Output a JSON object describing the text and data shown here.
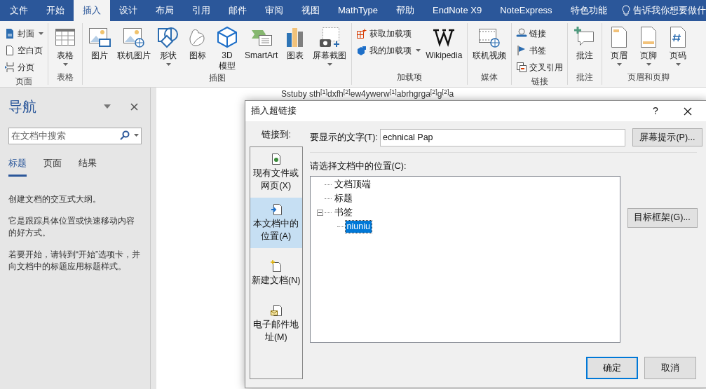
{
  "tabs": [
    {
      "label": "文件",
      "selected": false
    },
    {
      "label": "开始",
      "selected": false
    },
    {
      "label": "插入",
      "selected": true
    },
    {
      "label": "设计",
      "selected": false
    },
    {
      "label": "布局",
      "selected": false
    },
    {
      "label": "引用",
      "selected": false
    },
    {
      "label": "邮件",
      "selected": false
    },
    {
      "label": "审阅",
      "selected": false
    },
    {
      "label": "视图",
      "selected": false
    },
    {
      "label": "MathType",
      "selected": false
    },
    {
      "label": "帮助",
      "selected": false
    },
    {
      "label": "EndNote X9",
      "selected": false
    },
    {
      "label": "NoteExpress",
      "selected": false
    },
    {
      "label": "特色功能",
      "selected": false
    }
  ],
  "tell_me": "告诉我你想要做什",
  "ribbon": [
    {
      "label": "页面",
      "columns": [
        {
          "kind": "stack",
          "items": [
            {
              "label": "封面",
              "dropdown": true
            },
            {
              "label": "空白页",
              "dropdown": false
            },
            {
              "label": "分页",
              "dropdown": false
            }
          ]
        }
      ]
    },
    {
      "label": "表格",
      "columns": [
        {
          "kind": "large",
          "label": "表格",
          "dropdown": true
        }
      ]
    },
    {
      "label": "插图",
      "columns": [
        {
          "kind": "large",
          "label": "图片",
          "dropdown": false
        },
        {
          "kind": "large",
          "label": "联机图片",
          "dropdown": false
        },
        {
          "kind": "large",
          "label": "形状",
          "dropdown": true
        },
        {
          "kind": "large",
          "label": "图标",
          "dropdown": false
        },
        {
          "kind": "large",
          "label": "3D\n模型",
          "dropdown": false
        },
        {
          "kind": "large",
          "label": "SmartArt",
          "dropdown": false
        },
        {
          "kind": "large",
          "label": "图表",
          "dropdown": false
        },
        {
          "kind": "large",
          "label": "屏幕截图",
          "dropdown": true
        }
      ]
    },
    {
      "label": "加载项",
      "columns": [
        {
          "kind": "stack",
          "items": [
            {
              "label": "获取加载项",
              "dropdown": false
            },
            {
              "label": "我的加载项",
              "dropdown": true
            }
          ]
        },
        {
          "kind": "large",
          "label": "Wikipedia",
          "dropdown": false
        }
      ]
    },
    {
      "label": "媒体",
      "columns": [
        {
          "kind": "large",
          "label": "联机视频",
          "dropdown": false
        }
      ]
    },
    {
      "label": "链接",
      "columns": [
        {
          "kind": "stack",
          "items": [
            {
              "label": "链接",
              "dropdown": false
            },
            {
              "label": "书签",
              "dropdown": false
            },
            {
              "label": "交叉引用",
              "dropdown": false
            }
          ]
        }
      ]
    },
    {
      "label": "批注",
      "columns": [
        {
          "kind": "large",
          "label": "批注",
          "dropdown": false
        }
      ]
    },
    {
      "label": "页眉和页脚",
      "columns": [
        {
          "kind": "large",
          "label": "页眉",
          "dropdown": true
        },
        {
          "kind": "large",
          "label": "页脚",
          "dropdown": true
        },
        {
          "kind": "large",
          "label": "页码",
          "dropdown": true
        }
      ]
    }
  ],
  "navigation": {
    "title": "导航",
    "search_placeholder": "在文档中搜索",
    "tabs": [
      {
        "label": "标题",
        "selected": true
      },
      {
        "label": "页面",
        "selected": false
      },
      {
        "label": "结果",
        "selected": false
      }
    ],
    "paragraphs": [
      "创建文档的交互式大纲。",
      "它是跟踪具体位置或快速移动内容的好方式。",
      "若要开始，请转到“开始”选项卡，并向文档中的标题应用标题样式。"
    ]
  },
  "document_text": "Sstuby sth$^{[1]}$dxfh$^{[2]}$ew4ywerw$^{[1]}$abrhgrga$^{[2]}$g$^{[2]}$a",
  "dialog": {
    "title": "插入超链接",
    "help": "?",
    "link_to_label": "链接到:",
    "link_targets": [
      {
        "label": "现有文件或网页(X)",
        "selected": false
      },
      {
        "label": "本文档中的位置(A)",
        "selected": true
      },
      {
        "label": "新建文档(N)",
        "selected": false
      },
      {
        "label": "电子邮件地址(M)",
        "selected": false
      }
    ],
    "display_text_label": "要显示的文字(T):",
    "display_text": "echnical Pap",
    "screen_tip_button": "屏幕提示(P)...",
    "location_label": "请选择文档中的位置(C):",
    "tree": [
      {
        "label": "文档顶端",
        "selected": false
      },
      {
        "label": "标题",
        "selected": false
      },
      {
        "label": "书签",
        "selected": false,
        "expanded": true,
        "children": [
          {
            "label": "niuniu",
            "selected": true
          }
        ]
      }
    ],
    "target_frame_button": "目标框架(G)...",
    "ok_button": "确定",
    "cancel_button": "取消"
  }
}
